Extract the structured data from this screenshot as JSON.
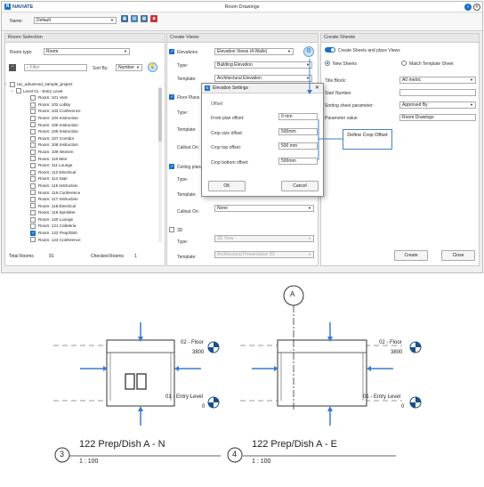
{
  "window": {
    "brand": "NAVIATE",
    "title": "Room Drawings"
  },
  "toolbar": {
    "name_label": "Name:",
    "name_value": "Default"
  },
  "room_selection": {
    "header": "Room Selection",
    "room_type_label": "Room type:",
    "room_type_value": "Room",
    "filter_placeholder": "Filter",
    "sort_by_label": "Sort By:",
    "sort_by_value": "Number",
    "project": "rac_advanced_sample_project",
    "level": "Level 01 - Entry Level",
    "rooms": [
      "Room: 101 Vest",
      "Room: 102 Lobby",
      "Room: 103 Conference",
      "Room: 104 Instruction",
      "Room: 105 Instruction",
      "Room: 106 Instruction",
      "Room: 107 Corridor",
      "Room: 108 Instruction",
      "Room: 109 Women",
      "Room: 110 Men",
      "Room: 111 Lounge",
      "Room: 112 Electrical",
      "Room: 114 Stair",
      "Room: 115 Instruction",
      "Room: 116 Conference",
      "Room: 117 Instruction",
      "Room: 118 Electrical",
      "Room: 119 Sprinkler",
      "Room: 120 Lounge",
      "Room: 121 Cafeteria",
      "Room: 122 Prep/Dish",
      "Room: 123 Conference"
    ],
    "checked_index": 20,
    "total_rooms_label": "Total Rooms",
    "total_rooms_value": "91",
    "checked_rooms_label": "Checked Rooms",
    "checked_rooms_value": "1"
  },
  "create_views": {
    "header": "Create Views",
    "elevations_label": "Elevations",
    "elevations_value": "Elevation Views (4 Walls)",
    "type_label": "Type:",
    "type_value": "Building Elevation",
    "template_label": "Template:",
    "template_value": "Architectural Elevation",
    "floor_plans_label": "Floor Plans",
    "type2_label": "Type:",
    "template2_label": "Template:",
    "callout_on_label": "Callout On:",
    "ceiling_plans_label": "Ceiling plans",
    "type3_label": "Type:",
    "template3_label": "Template:",
    "callout_on3_label": "Callout On:",
    "callout_on3_value": "None",
    "threed_label": "3D",
    "type4_label": "Type:",
    "type4_value": "3D View",
    "template4_label": "Template:",
    "template4_value": "Architectural Presentation 3D"
  },
  "elevation_settings": {
    "title": "Elevation Settings",
    "offset_label": "Offset",
    "fields": [
      {
        "label": "Front plan offset:",
        "value": "0 mm"
      },
      {
        "label": "Crop size offset:",
        "value": "500mm"
      },
      {
        "label": "Crop top offset:",
        "value": "500 mm"
      },
      {
        "label": "Crop bottom offset:",
        "value": "500mm"
      }
    ],
    "ok_label": "OK",
    "cancel_label": "Cancel"
  },
  "callout": {
    "text": "Define Crop Offset"
  },
  "create_sheets": {
    "header": "Create Sheets",
    "toggle_label": "Create Sheets and place Views",
    "new_sheets_label": "New Sheets",
    "match_template_label": "Match Template Sheet",
    "title_block_label": "Title Block:",
    "title_block_value": "A0 metric",
    "start_number_label": "Start Number",
    "sorting_label": "Sorting sheet parameter:",
    "sorting_value": "Approved By",
    "param_value_label": "Parameter value",
    "param_value_value": "Room Drawings",
    "create_label": "Create",
    "close_label": "Close"
  },
  "elevations": {
    "grid_bubble": "A",
    "floor_label": "02 - Floor",
    "floor_value": "3800",
    "entry_label": "01 - Entry Level",
    "entry_value": "0",
    "view_n_number": "3",
    "view_n_title": "122 Prep/Dish A - N",
    "view_n_scale": "1 : 100",
    "view_e_number": "4",
    "view_e_title": "122 Prep/Dish A - E",
    "view_e_scale": "1 : 100"
  },
  "colors": {
    "accent": "#1a6fc4",
    "arrow": "#3b7cc9"
  }
}
